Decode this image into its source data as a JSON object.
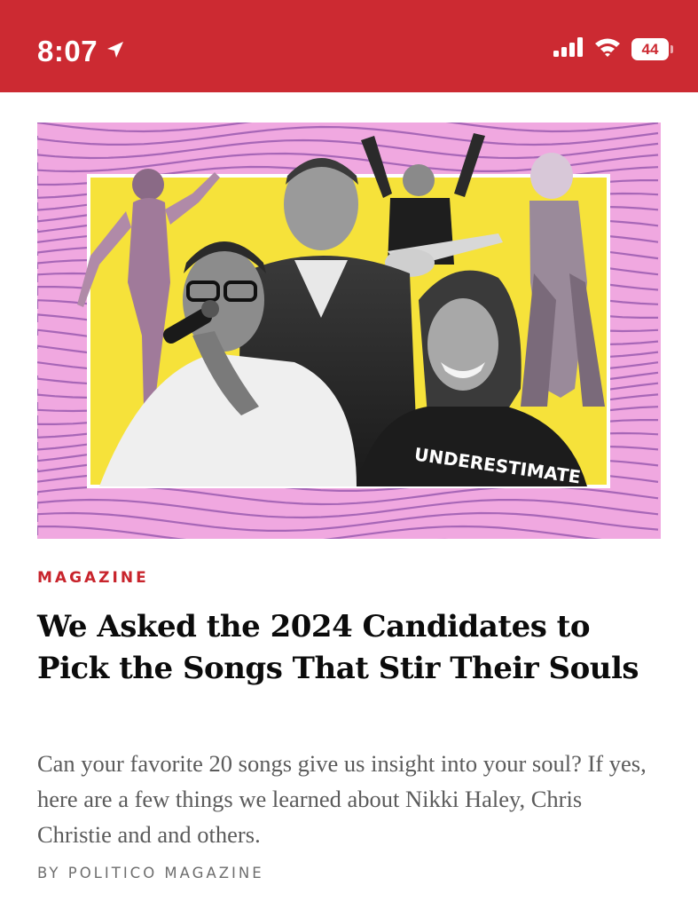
{
  "status_bar": {
    "time": "8:07",
    "battery": "44",
    "icons": [
      "location-arrow-icon",
      "cellular-signal-icon",
      "wifi-icon",
      "battery-icon"
    ],
    "background": "#cc2a32"
  },
  "article": {
    "hero_image_text": "UNDERESTIMATE",
    "section": "MAGAZINE",
    "headline": "We Asked the 2024 Candidates to Pick the Songs That Stir Their Souls",
    "dek": "Can your favorite 20 songs give us insight into your soul? If yes, here are a few things we learned about Nikki Haley, Chris Christie and and others.",
    "byline": "BY POLITICO MAGAZINE"
  },
  "colors": {
    "accent_red": "#c8242c",
    "hero_pink": "#f0a8e0",
    "hero_yellow": "#f6e23a"
  }
}
